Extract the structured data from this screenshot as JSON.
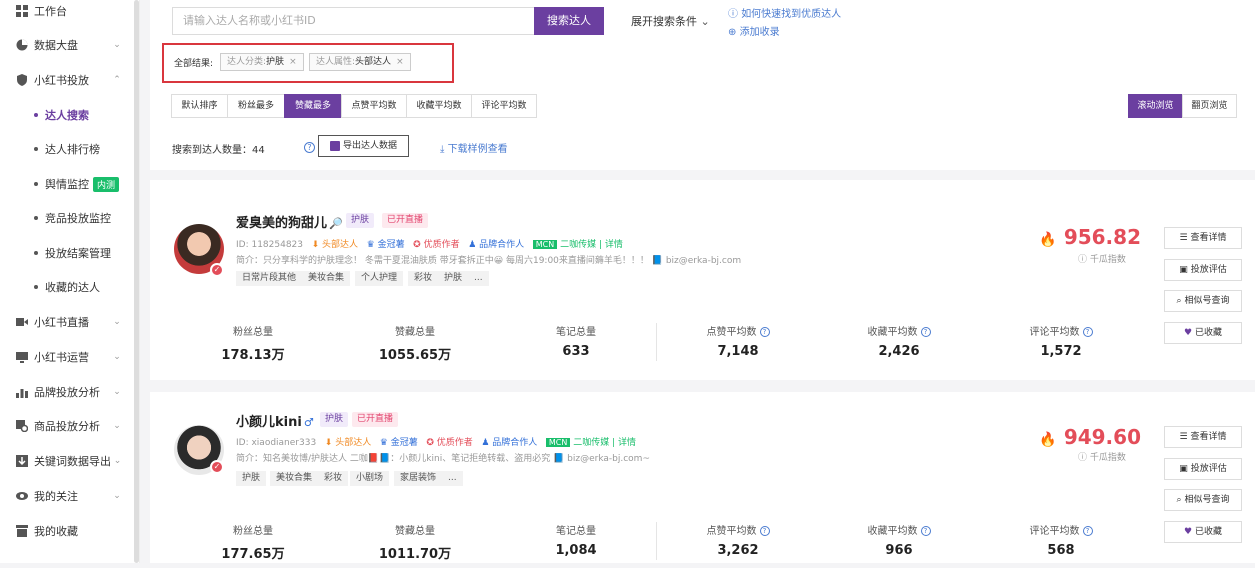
{
  "sidebar": {
    "items": [
      {
        "label": "工作台",
        "icon": "grid-icon",
        "chevron": ""
      },
      {
        "label": "数据大盘",
        "icon": "pie-chart-icon",
        "chevron": "⌄"
      },
      {
        "label": "小红书投放",
        "icon": "shield-icon",
        "chevron": "⌃"
      },
      {
        "label": "小红书直播",
        "icon": "video-icon",
        "chevron": "⌄"
      },
      {
        "label": "小红书运营",
        "icon": "monitor-icon",
        "chevron": "⌄"
      },
      {
        "label": "品牌投放分析",
        "icon": "bar-chart-icon",
        "chevron": "⌄"
      },
      {
        "label": "商品投放分析",
        "icon": "product-search-icon",
        "chevron": "⌄"
      },
      {
        "label": "关键词数据导出",
        "icon": "export-icon",
        "chevron": "⌄"
      },
      {
        "label": "我的关注",
        "icon": "eye-icon",
        "chevron": "⌄"
      },
      {
        "label": "我的收藏",
        "icon": "archive-icon",
        "chevron": ""
      }
    ],
    "sub_items": [
      {
        "label": "达人搜索",
        "badge": ""
      },
      {
        "label": "达人排行榜",
        "badge": ""
      },
      {
        "label": "舆情监控",
        "badge": "内测"
      },
      {
        "label": "竞品投放监控",
        "badge": ""
      },
      {
        "label": "投放结案管理",
        "badge": ""
      },
      {
        "label": "收藏的达人",
        "badge": ""
      }
    ]
  },
  "search": {
    "placeholder": "请输入达人名称或小红书ID",
    "button": "搜索达人",
    "expand_label": "展开搜索条件",
    "help_link": "如何快速找到优质达人",
    "add_link": "添加收录"
  },
  "filters": {
    "label": "全部结果:",
    "tags": [
      {
        "key": "达人分类:",
        "value": "护肤"
      },
      {
        "key": "达人属性:",
        "value": "头部达人"
      }
    ]
  },
  "sort_tabs": [
    "默认排序",
    "粉丝最多",
    "赞藏最多",
    "点赞平均数",
    "收藏平均数",
    "评论平均数"
  ],
  "view_modes": [
    "滚动浏览",
    "翻页浏览"
  ],
  "results": {
    "label": "搜索到达人数量：44",
    "export_button": "导出达人数据",
    "download_link": "下载样例查看"
  },
  "influencers": [
    {
      "name": "爱臭美的狗甜儿",
      "gender_symbol": "🔎",
      "category": "护肤",
      "live_tag": "已开直播",
      "id": "ID: 118254823",
      "attr_head": "头部达人",
      "attr_gold": "金冠薯",
      "attr_quality": "优质作者",
      "attr_brand": "品牌合作人",
      "mcn": "MCN",
      "mcn_name": "二咖传媒 | 详情",
      "bio": "简介：只分享科学的护肤理念！ 冬需干夏混油肤质 带牙套拆正中😀 每周六19:00来直播间薅羊毛！！！ 📘 biz@erka-bj.com",
      "tags": [
        "日常片段其他",
        "美妆合集",
        "个人护理",
        "彩妆",
        "护肤",
        "..."
      ],
      "score": "956.82",
      "score_label": "千瓜指数",
      "stats": {
        "fans_label": "粉丝总量",
        "fans": "178.13万",
        "likes_label": "赞藏总量",
        "likes": "1055.65万",
        "notes_label": "笔记总量",
        "notes": "633",
        "avg_like_label": "点赞平均数",
        "avg_like": "7,148",
        "avg_fav_label": "收藏平均数",
        "avg_fav": "2,426",
        "avg_comment_label": "评论平均数",
        "avg_comment": "1,572"
      },
      "actions": [
        "查看详情",
        "投放评估",
        "相似号查询",
        "已收藏"
      ]
    },
    {
      "name": "小颜儿kini",
      "gender_symbol": "♂",
      "category": "护肤",
      "live_tag": "已开直播",
      "id": "ID: xiaodianer333",
      "attr_head": "头部达人",
      "attr_gold": "金冠薯",
      "attr_quality": "优质作者",
      "attr_brand": "品牌合作人",
      "mcn": "MCN",
      "mcn_name": "二咖传媒 | 详情",
      "bio": "简介：知名美妆博/护肤达人 二咖📕📘：小颜儿kini、笔记拒绝转载、盗用必究 📘 biz@erka-bj.com~",
      "tags": [
        "护肤",
        "美妆合集",
        "彩妆",
        "小剧场",
        "家居装饰",
        "..."
      ],
      "score": "949.60",
      "score_label": "千瓜指数",
      "stats": {
        "fans_label": "粉丝总量",
        "fans": "177.65万",
        "likes_label": "赞藏总量",
        "likes": "1011.70万",
        "notes_label": "笔记总量",
        "notes": "1,084",
        "avg_like_label": "点赞平均数",
        "avg_like": "3,262",
        "avg_fav_label": "收藏平均数",
        "avg_fav": "966",
        "avg_comment_label": "评论平均数",
        "avg_comment": "568"
      },
      "actions": [
        "查看详情",
        "投放评估",
        "相似号查询",
        "已收藏"
      ]
    }
  ],
  "colors": {
    "accent": "#6b3fa0",
    "score": "#e34d59",
    "link": "#4a7bd0"
  }
}
